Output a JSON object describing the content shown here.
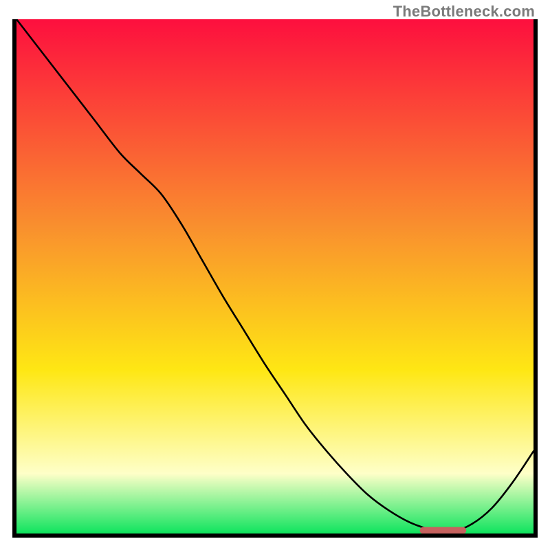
{
  "attribution": "TheBottleneck.com",
  "colors": {
    "frame": "#000000",
    "curve": "#000000",
    "marker": "#c6625f",
    "grad_top": "#fd0f3e",
    "grad_mid_upper": "#f98f2e",
    "grad_mid": "#fee714",
    "grad_lower": "#feffc8",
    "grad_bottom": "#06e35a"
  },
  "chart_data": {
    "type": "line",
    "title": "",
    "xlabel": "",
    "ylabel": "",
    "xlim": [
      0,
      1
    ],
    "ylim": [
      0,
      1
    ],
    "grid": false,
    "x": [
      0.0,
      0.05,
      0.1,
      0.15,
      0.2,
      0.24,
      0.28,
      0.32,
      0.36,
      0.4,
      0.44,
      0.48,
      0.52,
      0.56,
      0.6,
      0.64,
      0.68,
      0.72,
      0.76,
      0.8,
      0.84,
      0.88,
      0.92,
      0.96,
      1.0
    ],
    "values": [
      1.0,
      0.935,
      0.87,
      0.805,
      0.74,
      0.7,
      0.66,
      0.6,
      0.53,
      0.46,
      0.395,
      0.33,
      0.27,
      0.21,
      0.16,
      0.115,
      0.075,
      0.045,
      0.022,
      0.008,
      0.003,
      0.018,
      0.05,
      0.1,
      0.16
    ],
    "optimal_band": {
      "x_start": 0.78,
      "x_end": 0.87,
      "y": 0.006
    },
    "gradient_stops": [
      {
        "pos": 0.0,
        "color": "grad_top"
      },
      {
        "pos": 0.4,
        "color": "grad_mid_upper"
      },
      {
        "pos": 0.68,
        "color": "grad_mid"
      },
      {
        "pos": 0.88,
        "color": "grad_lower"
      },
      {
        "pos": 1.0,
        "color": "grad_bottom"
      }
    ]
  }
}
